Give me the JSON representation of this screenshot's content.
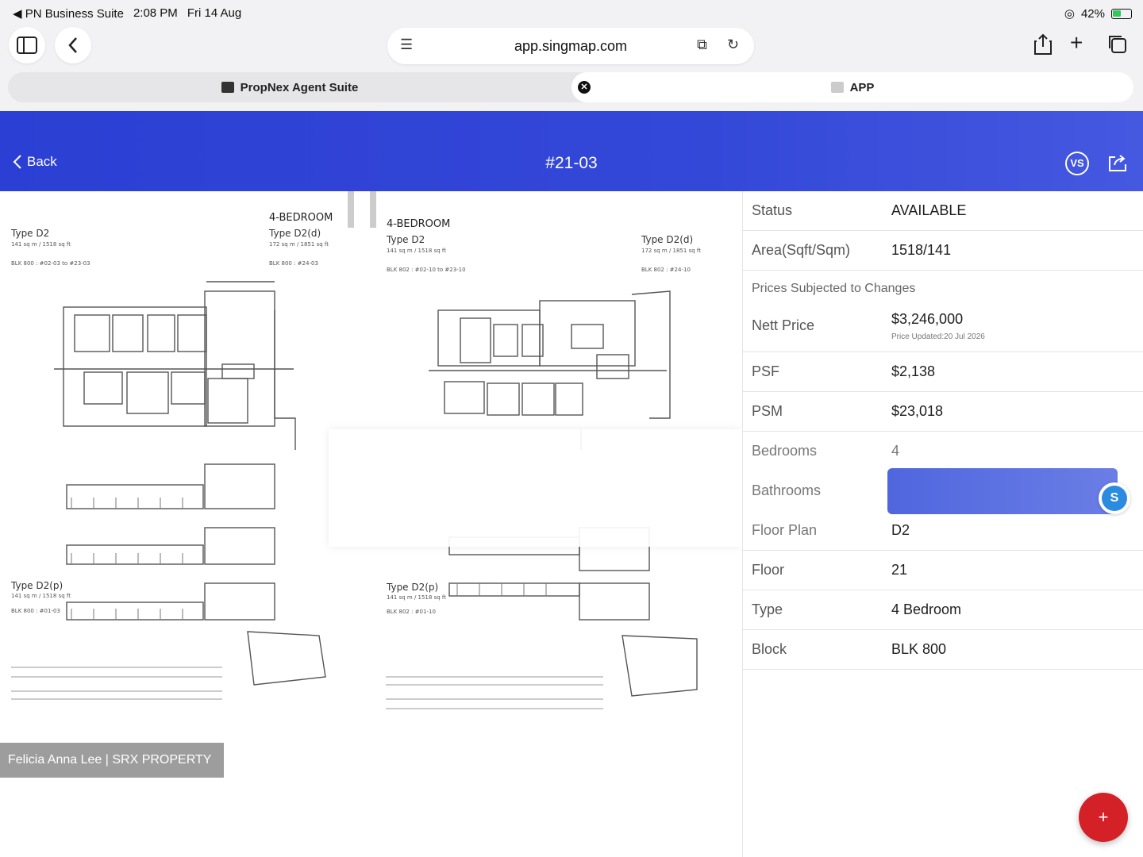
{
  "status_bar": {
    "carrier": "◀ PN Business Suite",
    "time": "2:08 PM",
    "date": "Fri 14 Aug",
    "battery": "42%"
  },
  "browser": {
    "url": "app.singmap.com",
    "tabs": [
      {
        "label": "PropNex Agent Suite"
      },
      {
        "label": "APP"
      }
    ]
  },
  "header": {
    "back_label": "Back",
    "title": "#21-03",
    "vs_label": "VS"
  },
  "floorplan": {
    "left": {
      "heading": "4-BEDROOM",
      "type_main": "Type D2",
      "type_main_area": "141 sq m / 1518 sq ft",
      "type_main_blk": "BLK 800 : #02-03 to #23-03",
      "type_alt": "Type D2(d)",
      "type_alt_area": "172 sq m / 1851 sq ft",
      "type_alt_blk": "BLK 800 : #24-03",
      "type_p": "Type D2(p)",
      "type_p_area": "141 sq m / 1518 sq ft",
      "type_p_blk": "BLK 800 : #01-03"
    },
    "right": {
      "heading": "4-BEDROOM",
      "type_main": "Type D2",
      "type_main_area": "141 sq m / 1518 sq ft",
      "type_main_blk": "BLK 802 : #02-10 to #23-10",
      "type_alt": "Type D2(d)",
      "type_alt_area": "172 sq m / 1851 sq ft",
      "type_alt_blk": "BLK 802 : #24-10",
      "type_p": "Type D2(p)",
      "type_p_area": "141 sq m / 1518 sq ft",
      "type_p_blk": "BLK 802 : #01-10"
    },
    "watermark": "Felicia Anna Lee | SRX PROPERTY"
  },
  "details": {
    "status": {
      "label": "Status",
      "value": "AVAILABLE"
    },
    "area": {
      "label": "Area(Sqft/Sqm)",
      "value": "1518/141"
    },
    "prices_note": "Prices Subjected to Changes",
    "nett_price": {
      "label": "Nett Price",
      "value": "$3,246,000",
      "updated": "Price Updated:20 Jul 2026"
    },
    "psf": {
      "label": "PSF",
      "value": "$2,138"
    },
    "psm": {
      "label": "PSM",
      "value": "$23,018"
    },
    "bedrooms": {
      "label": "Bedrooms",
      "value": "4"
    },
    "bathrooms": {
      "label": "Bathrooms",
      "value": ""
    },
    "floor_plan": {
      "label": "Floor Plan",
      "value": "D2"
    },
    "floor": {
      "label": "Floor",
      "value": "21"
    },
    "type": {
      "label": "Type",
      "value": "4 Bedroom"
    },
    "block": {
      "label": "Block",
      "value": "BLK 800"
    }
  },
  "fab_label": "+",
  "colors": {
    "header_blue": "#3347d8",
    "fab_red": "#d42128"
  }
}
